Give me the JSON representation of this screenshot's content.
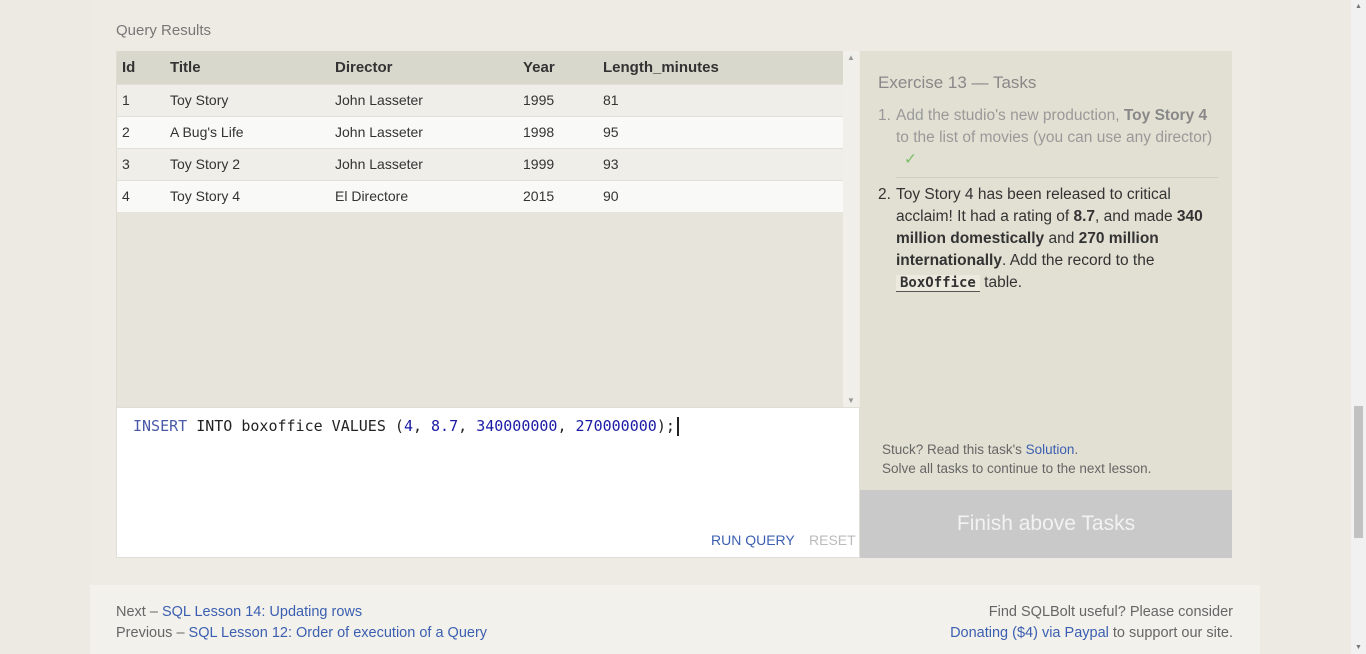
{
  "results": {
    "label": "Query Results",
    "columns": [
      "Id",
      "Title",
      "Director",
      "Year",
      "Length_minutes"
    ],
    "rows": [
      [
        "1",
        "Toy Story",
        "John Lasseter",
        "1995",
        "81"
      ],
      [
        "2",
        "A Bug's Life",
        "John Lasseter",
        "1998",
        "95"
      ],
      [
        "3",
        "Toy Story 2",
        "John Lasseter",
        "1999",
        "93"
      ],
      [
        "4",
        "Toy Story 4",
        "El Directore",
        "2015",
        "90"
      ]
    ]
  },
  "editor": {
    "kw_insert": "INSERT",
    "mid_text": " INTO boxoffice VALUES (",
    "n1": "4",
    "n2": "8.7",
    "n3": "340000000",
    "n4": "270000000",
    "end": ");",
    "comma": ", ",
    "run_label": "RUN QUERY",
    "reset_label": "RESET"
  },
  "tasks": {
    "title": "Exercise 13 — Tasks",
    "task1": {
      "num": "1.",
      "pre": "Add the studio's new production, ",
      "bold": "Toy Story 4",
      "post": " to the list of movies (you can use any director)",
      "check": "✓"
    },
    "task2": {
      "num": "2.",
      "p1": "Toy Story 4 has been released to critical acclaim! It had a rating of ",
      "b1": "8.7",
      "p2": ", and made ",
      "b2": "340 million domestically",
      "p3": " and ",
      "b3": "270 million internationally",
      "p4": ". Add the record to the ",
      "code": "BoxOffice",
      "p5": " table."
    },
    "stuck_pre": "Stuck? Read this task's ",
    "stuck_link": "Solution",
    "stuck_post": ".",
    "solve_note": "Solve all tasks to continue to the next lesson.",
    "finish_label": "Finish above Tasks"
  },
  "footer": {
    "next_pre": "Next – ",
    "next_link": "SQL Lesson 14: Updating rows",
    "prev_pre": "Previous – ",
    "prev_link": "SQL Lesson 12: Order of execution of a Query",
    "useful": "Find SQLBolt useful? Please consider",
    "donate_link": "Donating ($4) via Paypal",
    "donate_post": " to support our site."
  }
}
